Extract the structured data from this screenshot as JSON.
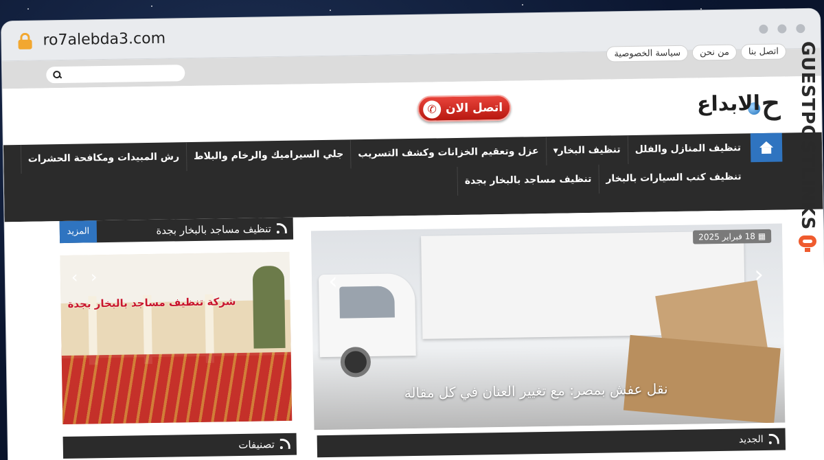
{
  "browser": {
    "url": "ro7alebda3.com"
  },
  "side_brand": {
    "text": "GUESTPOSTLINKS"
  },
  "site": {
    "top_links": [
      "اتصل بنا",
      "من نحن",
      "سياسة الخصوصية"
    ],
    "logo": {
      "mark": "ح",
      "word": "الابداع"
    },
    "call_button": "اتصل الان",
    "nav": {
      "row1": [
        "تنظيف المنازل والفلل",
        "تنظيف البخار▾",
        "عزل وتعقيم الخزانات وكشف التسريب",
        "جلي السيراميك والرخام والبلاط",
        "رش المبيدات ومكافحة الحشرات"
      ],
      "row2": [
        "تنظيف كنب السيارات بالبخار",
        "تنظيف مساجد بالبخار بجدة"
      ]
    },
    "slider": {
      "date": "18 فبراير 2025",
      "caption": "نقل عفش بمصر: مع تغيير العنان في كل مقالة"
    },
    "new_section": "الجديد",
    "widget": {
      "title": "تنظيف مساجد بالبخار بجدة",
      "more": "المزيد",
      "image_text": "شركة تنظيف مساجد بالبخار بجدة"
    },
    "categories": "تصنيفات"
  },
  "colors": {
    "nav_bg": "#2b2b2b",
    "accent_blue": "#2f74c0",
    "call_red": "#c8231b",
    "brand_orange": "#ef5b2e"
  }
}
